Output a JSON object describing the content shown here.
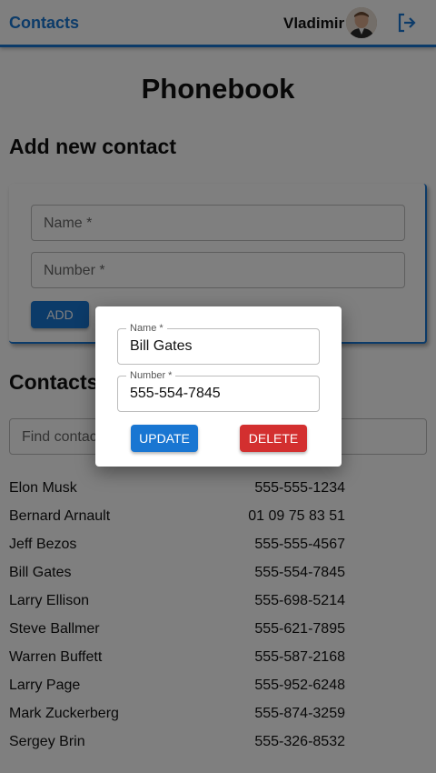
{
  "header": {
    "brand": "Contacts",
    "user_name": "Vladimir",
    "avatar_icon": "user-avatar",
    "logout_icon": "logout-icon"
  },
  "page": {
    "title": "Phonebook",
    "add_heading": "Add new contact",
    "contacts_heading": "Contacts"
  },
  "add_form": {
    "name_placeholder": "Name *",
    "number_placeholder": "Number *",
    "add_label": "ADD"
  },
  "filter": {
    "placeholder": "Find contacts by name"
  },
  "contacts": [
    {
      "name": "Elon Musk",
      "number": "555-555-1234"
    },
    {
      "name": "Bernard Arnault",
      "number": "01 09 75 83 51"
    },
    {
      "name": "Jeff Bezos",
      "number": "555-555-4567"
    },
    {
      "name": "Bill Gates",
      "number": "555-554-7845"
    },
    {
      "name": "Larry Ellison",
      "number": "555-698-5214"
    },
    {
      "name": "Steve Ballmer",
      "number": "555-621-7895"
    },
    {
      "name": "Warren Buffett",
      "number": "555-587-2168"
    },
    {
      "name": "Larry Page",
      "number": "555-952-6248"
    },
    {
      "name": "Mark Zuckerberg",
      "number": "555-874-3259"
    },
    {
      "name": "Sergey Brin",
      "number": "555-326-8532"
    }
  ],
  "modal": {
    "name_label": "Name *",
    "name_value": "Bill Gates",
    "number_label": "Number *",
    "number_value": "555-554-7845",
    "update_label": "UPDATE",
    "delete_label": "DELETE"
  },
  "colors": {
    "primary": "#1976d2",
    "danger": "#d32f2f"
  }
}
